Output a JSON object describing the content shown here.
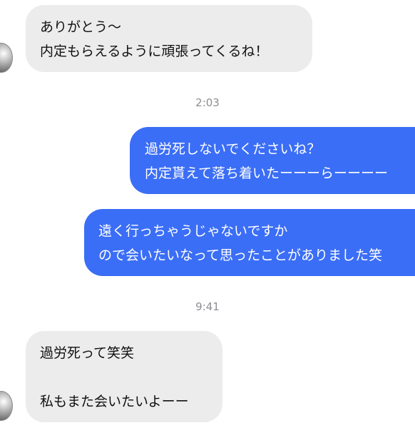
{
  "messages": [
    {
      "lines": [
        "ありがとう〜",
        "内定もらえるように頑張ってくるね！"
      ]
    },
    {
      "lines": [
        "過労死しないでくださいね？",
        "内定貰えて落ち着いたーーーらーーーー"
      ]
    },
    {
      "lines": [
        "遠く行っちゃうじゃないですか",
        "ので会いたいなって思ったことがありました笑"
      ]
    },
    {
      "lines": [
        "過労死って笑笑",
        "",
        "私もまた会いたいよーー"
      ]
    }
  ],
  "timestamps": [
    "2:03",
    "9:41"
  ]
}
